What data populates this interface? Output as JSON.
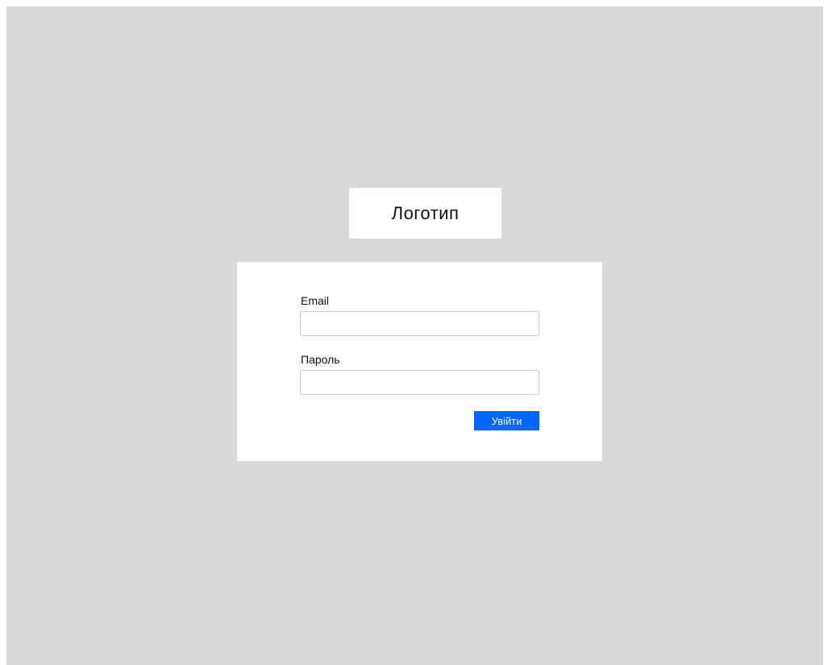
{
  "logo": {
    "text": "Логотип"
  },
  "form": {
    "email_label": "Email",
    "email_value": "",
    "email_placeholder": "",
    "password_label": "Пароль",
    "password_value": "",
    "password_placeholder": "",
    "submit_label": "Увійти"
  },
  "colors": {
    "background": "#d9d9d9",
    "card": "#ffffff",
    "accent": "#0066ff"
  }
}
